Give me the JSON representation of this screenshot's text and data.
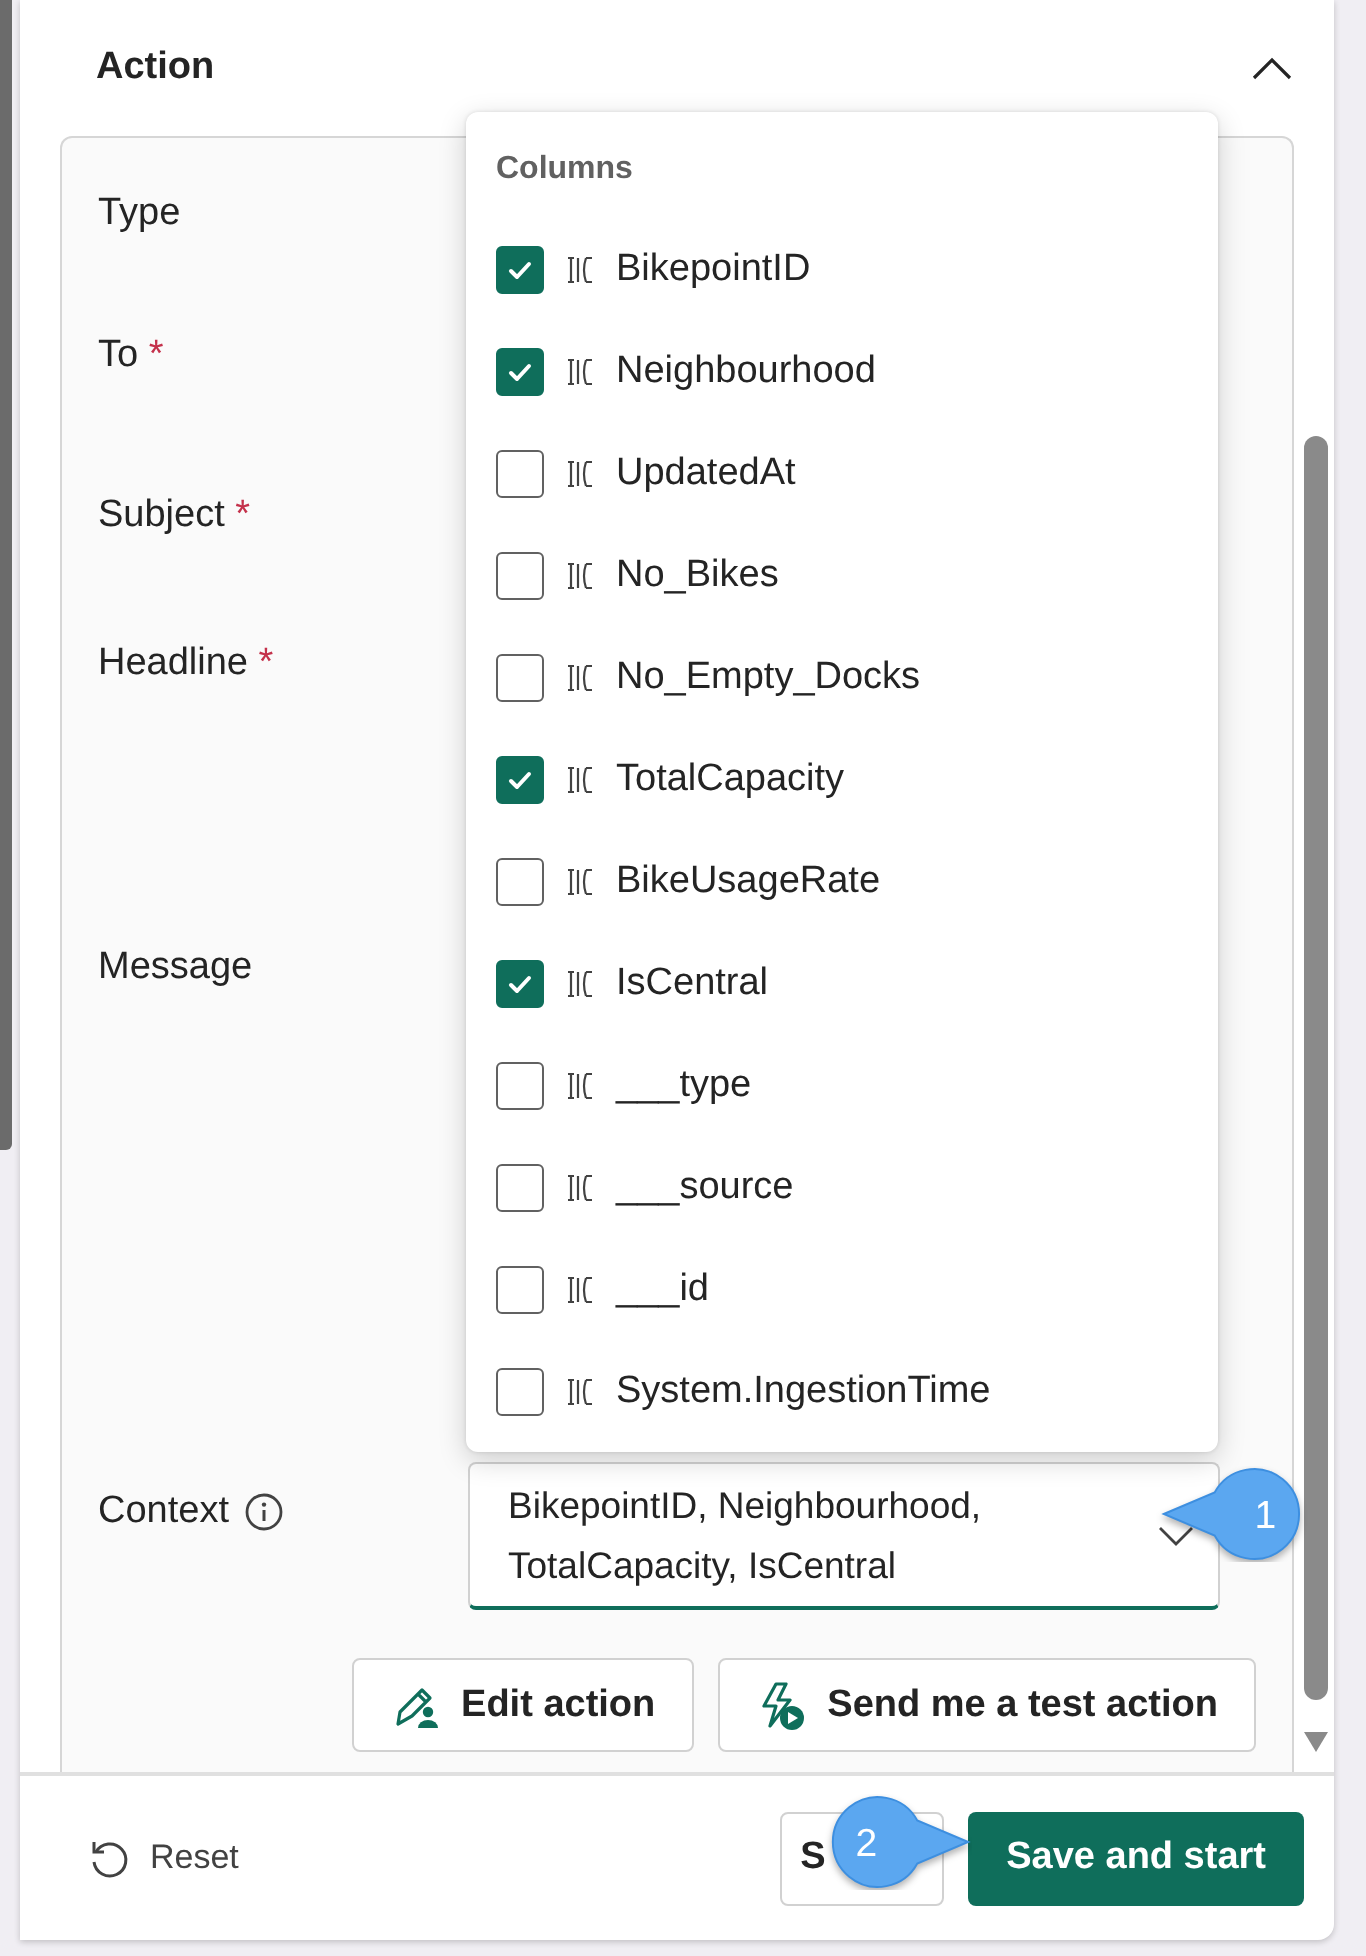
{
  "section": {
    "title": "Action",
    "expanded": true
  },
  "fields": [
    {
      "label": "Type",
      "required": false
    },
    {
      "label": "To",
      "required": true
    },
    {
      "label": "Subject",
      "required": true
    },
    {
      "label": "Headline",
      "required": true
    },
    {
      "label": "Message",
      "required": false
    }
  ],
  "required_mark": "*",
  "context": {
    "label": "Context",
    "value": "BikepointID, Neighbourhood, TotalCapacity, IsCentral"
  },
  "dropdown": {
    "title": "Columns",
    "options": [
      {
        "label": "BikepointID",
        "checked": true
      },
      {
        "label": "Neighbourhood",
        "checked": true
      },
      {
        "label": "UpdatedAt",
        "checked": false
      },
      {
        "label": "No_Bikes",
        "checked": false
      },
      {
        "label": "No_Empty_Docks",
        "checked": false
      },
      {
        "label": "TotalCapacity",
        "checked": true
      },
      {
        "label": "BikeUsageRate",
        "checked": false
      },
      {
        "label": "IsCentral",
        "checked": true
      },
      {
        "label": "___type",
        "checked": false
      },
      {
        "label": "___source",
        "checked": false
      },
      {
        "label": "___id",
        "checked": false
      },
      {
        "label": "System.IngestionTime",
        "checked": false
      }
    ]
  },
  "action_buttons": [
    "Edit action",
    "Send me a test action"
  ],
  "footer": {
    "reset": "Reset",
    "secondary": "S",
    "primary": "Save and start"
  },
  "callouts": [
    "1",
    "2"
  ]
}
